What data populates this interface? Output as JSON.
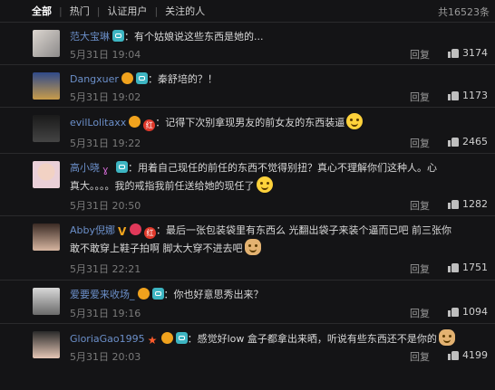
{
  "tabs": {
    "all": "全部",
    "hot": "热门",
    "verified": "认证用户",
    "following": "关注的人",
    "total": "共16523条"
  },
  "actions": {
    "reply": "回复"
  },
  "comments": [
    {
      "name": "范大宝琳",
      "text": "：有个姑娘说这些东西是她的...",
      "time": "5月31日 19:04",
      "likes": "3174"
    },
    {
      "name": "Dangxuer",
      "text": "：秦舒培的？！",
      "time": "5月31日 19:02",
      "likes": "1173"
    },
    {
      "name": "evilLolitaxx",
      "text": "：记得下次别拿现男友的前女友的东西装逼",
      "time": "5月31日 19:22",
      "likes": "2465"
    },
    {
      "name": "高小晓",
      "text": "：用着自己现任的前任的东西不觉得别扭？真心不理解你们这种人。心",
      "text2": "真大。。。。我的戒指我前任送给她的现任了",
      "time": "5月31日 20:50",
      "likes": "1282"
    },
    {
      "name": "Abby倪娜",
      "text": "：最后一张包装袋里有东西么 光翻出袋子来装个逼而已吧 前三张你",
      "text2": "敢不敢穿上鞋子拍啊 脚太大穿不进去吧",
      "time": "5月31日 22:21",
      "likes": "1751"
    },
    {
      "name": "爱要爱来收场_",
      "text": "：你也好意思秀出来？",
      "time": "5月31日 19:16",
      "likes": "1094"
    },
    {
      "name": "GloriaGao1995",
      "text": "：感觉好low 盒子都拿出来晒，听说有些东西还不是你的",
      "time": "5月31日 20:03",
      "likes": "4199"
    }
  ]
}
